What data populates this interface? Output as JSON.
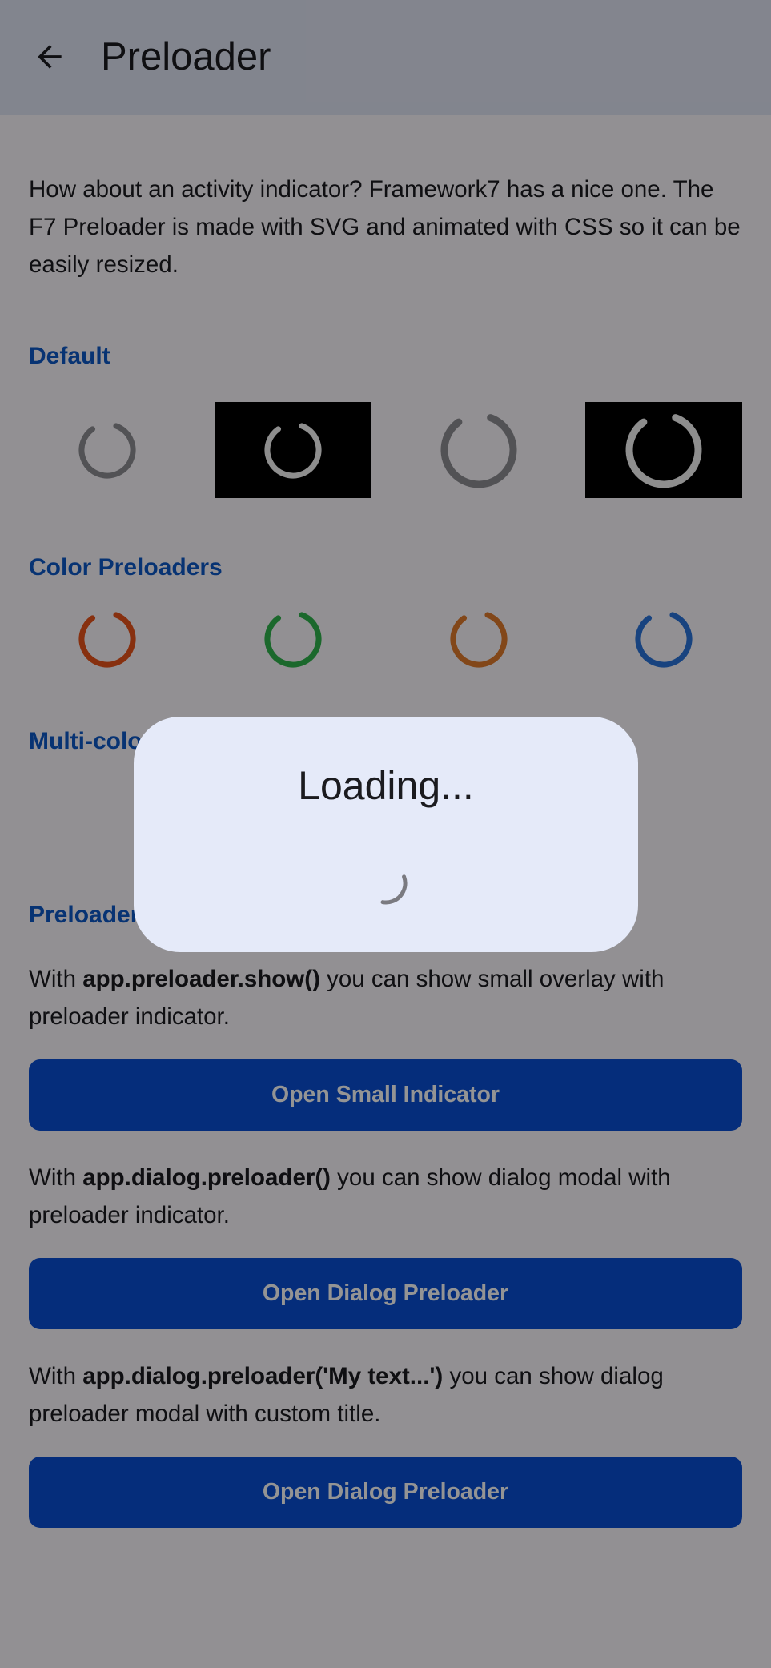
{
  "navbar": {
    "title": "Preloader",
    "back_icon": "arrow-left-icon"
  },
  "intro_text": "How about an activity indicator? Framework7 has a nice one. The F7 Preloader is made with SVG and animated with CSS so it can be easily resized.",
  "sections": {
    "default_title": "Default",
    "color_title": "Color Preloaders",
    "multicolor_title": "Multi-color",
    "modal_title": "Preloader Modals"
  },
  "color_preloaders": [
    "#e8531a",
    "#2fb34c",
    "#e07a2c",
    "#2a74db"
  ],
  "modals": [
    {
      "prefix": "With ",
      "code": "app.preloader.show()",
      "suffix": " you can show small overlay with preloader indicator.",
      "button": "Open Small Indicator"
    },
    {
      "prefix": "With ",
      "code": "app.dialog.preloader()",
      "suffix": " you can show dialog modal with preloader indicator.",
      "button": "Open Dialog Preloader"
    },
    {
      "prefix": "With ",
      "code": "app.dialog.preloader('My text...')",
      "suffix": " you can show dialog preloader modal with custom title.",
      "button": "Open Dialog Preloader"
    }
  ],
  "dialog": {
    "title": "Loading..."
  }
}
